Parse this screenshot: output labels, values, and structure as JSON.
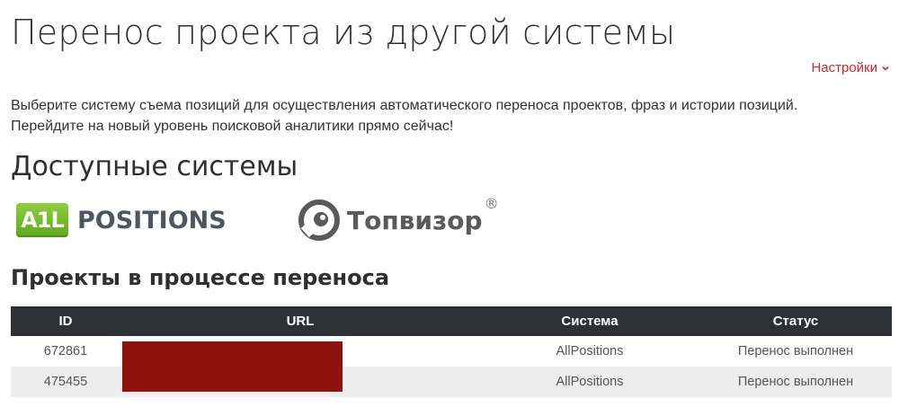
{
  "page": {
    "title": "Перенос проекта из другой системы",
    "settings_label": "Настройки",
    "intro_line1": "Выберите систему съема позиций для осуществления автоматического переноса проектов, фраз и истории позиций.",
    "intro_line2": "Перейдите на новый уровень поисковой аналитики прямо сейчас!"
  },
  "systems": {
    "title": "Доступные системы",
    "items": [
      {
        "badge": "A1L",
        "name": "POSITIONS",
        "icon": "a1-positions-logo"
      },
      {
        "name": "Топвизор",
        "mark": "®",
        "icon": "topvizor-logo"
      }
    ]
  },
  "projects": {
    "title": "Проекты в процессе переноса",
    "columns": [
      "ID",
      "URL",
      "Система",
      "Статус"
    ],
    "rows": [
      {
        "id": "672861",
        "url": "",
        "system": "AllPositions",
        "status": "Перенос выполнен"
      },
      {
        "id": "475455",
        "url": "",
        "system": "AllPositions",
        "status": "Перенос выполнен"
      }
    ]
  },
  "colors": {
    "accent": "#d9232d",
    "table_header": "#2d3035",
    "redaction": "#8e1310",
    "a1_green": "#6ab829"
  }
}
